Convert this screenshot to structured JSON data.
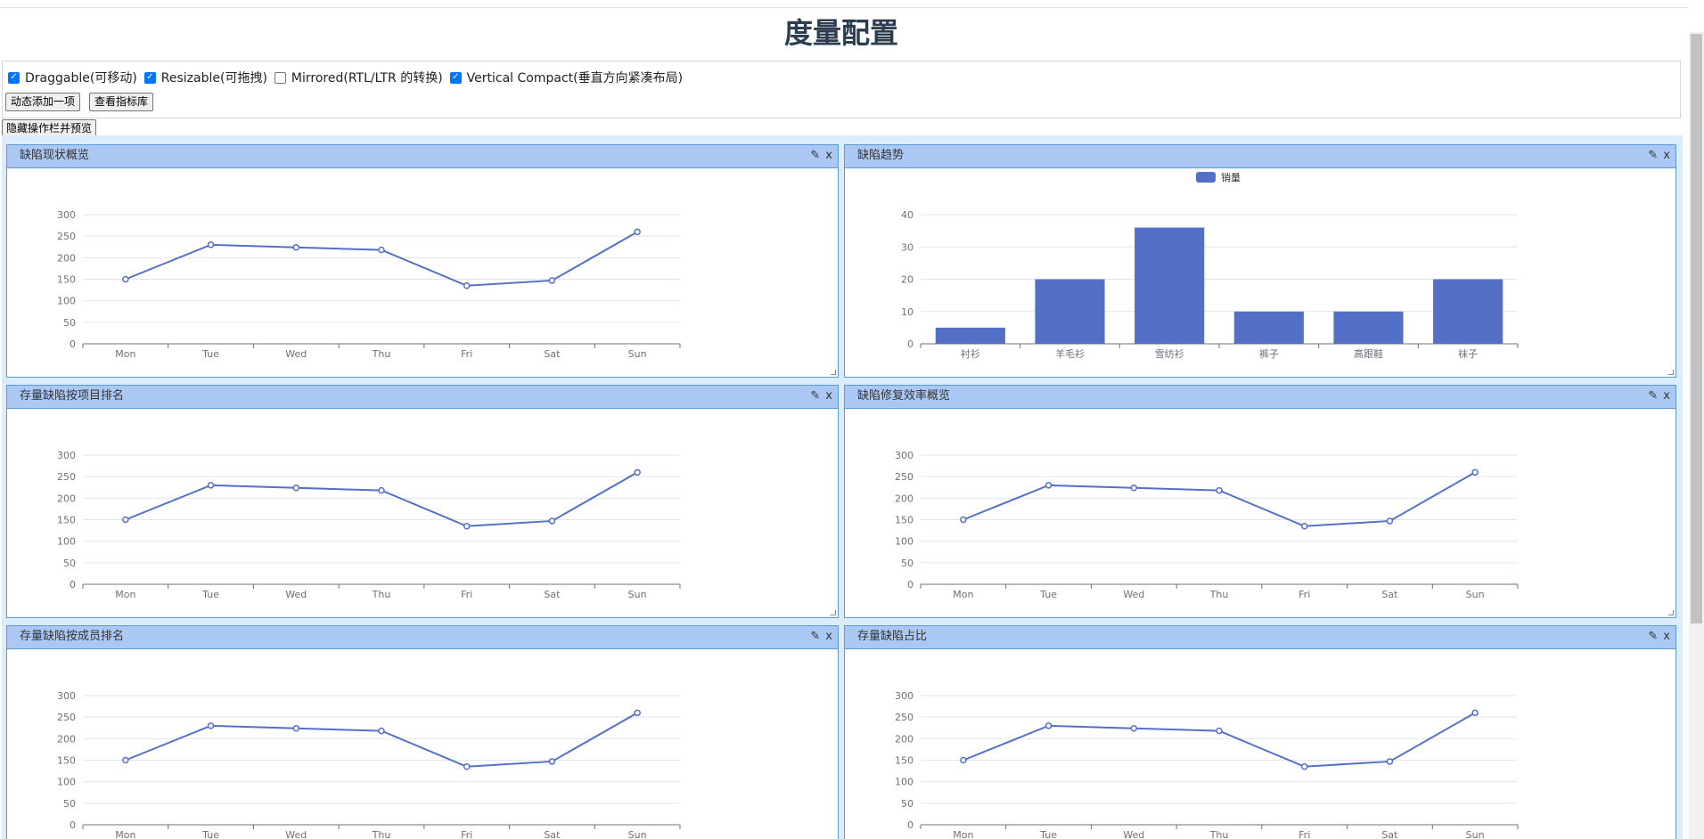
{
  "page": {
    "title": "度量配置"
  },
  "options": [
    {
      "label": "Draggable(可移动)",
      "checked": true
    },
    {
      "label": "Resizable(可拖拽)",
      "checked": true
    },
    {
      "label": "Mirrored(RTL/LTR 的转换)",
      "checked": false
    },
    {
      "label": "Vertical Compact(垂直方向紧凑布局)",
      "checked": true
    }
  ],
  "buttons": {
    "add": "动态添加一项",
    "library": "查看指标库",
    "hide": "隐藏操作栏并预览"
  },
  "panel_icons": {
    "edit": "✎",
    "close": "x"
  },
  "panels": [
    {
      "title": "缺陷现状概览"
    },
    {
      "title": "缺陷趋势"
    },
    {
      "title": "存量缺陷按项目排名"
    },
    {
      "title": "缺陷修复效率概览"
    },
    {
      "title": "存量缺陷按成员排名"
    },
    {
      "title": "存量缺陷占比"
    }
  ],
  "colors": {
    "series": "#5470c6",
    "header": "#abc8f5",
    "border": "#5b9bd5",
    "grid_bg": "#dcecfa"
  },
  "chart_data": [
    {
      "type": "line",
      "categories": [
        "Mon",
        "Tue",
        "Wed",
        "Thu",
        "Fri",
        "Sat",
        "Sun"
      ],
      "values": [
        150,
        230,
        224,
        218,
        135,
        147,
        260
      ],
      "ylim": [
        0,
        300
      ],
      "yticks": [
        0,
        50,
        100,
        150,
        200,
        250,
        300
      ]
    },
    {
      "type": "bar",
      "categories": [
        "衬衫",
        "羊毛衫",
        "雪纺衫",
        "裤子",
        "高跟鞋",
        "袜子"
      ],
      "series": [
        {
          "name": "销量",
          "values": [
            5,
            20,
            36,
            10,
            10,
            20
          ]
        }
      ],
      "ylim": [
        0,
        40
      ],
      "yticks": [
        0,
        10,
        20,
        30,
        40
      ],
      "legend": "top-center"
    },
    {
      "type": "line",
      "categories": [
        "Mon",
        "Tue",
        "Wed",
        "Thu",
        "Fri",
        "Sat",
        "Sun"
      ],
      "values": [
        150,
        230,
        224,
        218,
        135,
        147,
        260
      ],
      "ylim": [
        0,
        300
      ],
      "yticks": [
        0,
        50,
        100,
        150,
        200,
        250,
        300
      ]
    },
    {
      "type": "line",
      "categories": [
        "Mon",
        "Tue",
        "Wed",
        "Thu",
        "Fri",
        "Sat",
        "Sun"
      ],
      "values": [
        150,
        230,
        224,
        218,
        135,
        147,
        260
      ],
      "ylim": [
        0,
        300
      ],
      "yticks": [
        0,
        50,
        100,
        150,
        200,
        250,
        300
      ]
    },
    {
      "type": "line",
      "categories": [
        "Mon",
        "Tue",
        "Wed",
        "Thu",
        "Fri",
        "Sat",
        "Sun"
      ],
      "values": [
        150,
        230,
        224,
        218,
        135,
        147,
        260
      ],
      "ylim": [
        0,
        300
      ],
      "yticks": [
        0,
        50,
        100,
        150,
        200,
        250,
        300
      ]
    },
    {
      "type": "line",
      "categories": [
        "Mon",
        "Tue",
        "Wed",
        "Thu",
        "Fri",
        "Sat",
        "Sun"
      ],
      "values": [
        150,
        230,
        224,
        218,
        135,
        147,
        260
      ],
      "ylim": [
        0,
        300
      ],
      "yticks": [
        0,
        50,
        100,
        150,
        200,
        250,
        300
      ]
    }
  ]
}
